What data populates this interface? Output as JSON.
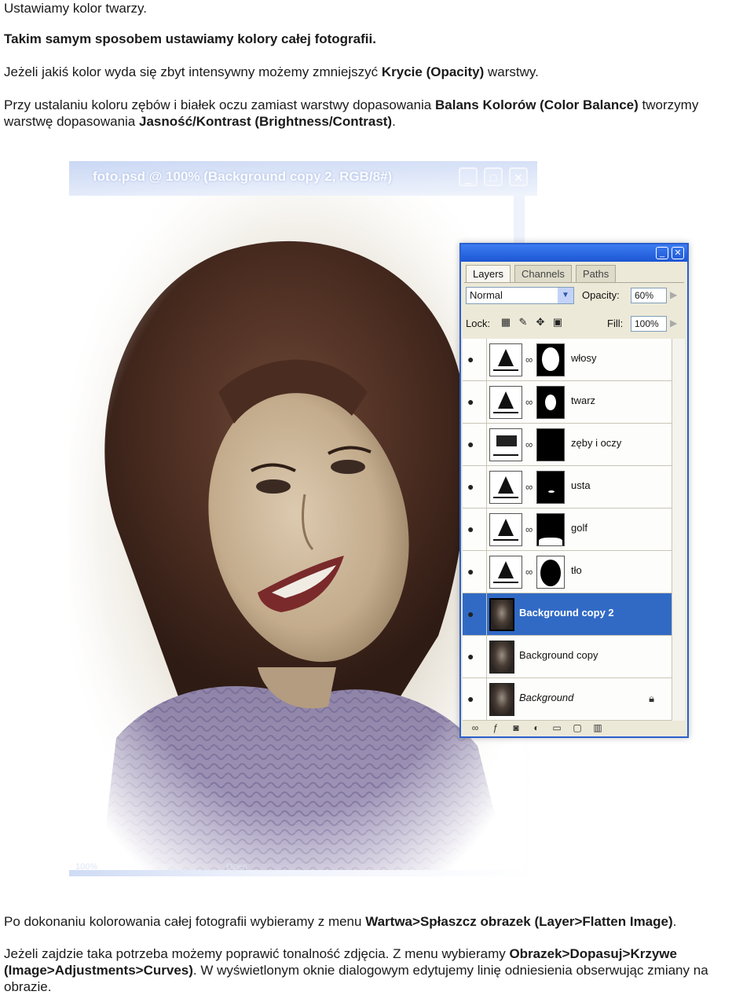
{
  "text": {
    "p1": "Ustawiamy kolor twarzy.",
    "p2": "Takim samym sposobem ustawiamy kolory całej fotografii.",
    "p3a": "Jeżeli jakiś kolor wyda się zbyt intensywny możemy zmniejszyć ",
    "p3b": "Krycie (Opacity)",
    "p3c": " warstwy.",
    "p4a": "Przy ustalaniu koloru zębów i białek oczu zamiast warstwy dopasowania ",
    "p4b": "Balans Kolorów (Color Balance)",
    "p4c": " tworzymy warstwę dopasowania ",
    "p4d": "Jasność/Kontrast (Brightness/Contrast)",
    "p4e": ".",
    "p5a": "Po dokonaniu kolorowania całej fotografii wybieramy z menu ",
    "p5b": "Wartwa>Spłaszcz obrazek (Layer>Flatten Image)",
    "p5c": ".",
    "p6a": "Jeżeli zajdzie taka potrzeba możemy poprawić tonalność zdjęcia. Z menu wybieramy ",
    "p6b": "Obrazek>Dopasuj>Krzywe (Image>Adjustments>Curves)",
    "p6c": ". W wyświetlonym oknie dialogowym edytujemy linię odniesienia obserwując zmiany na obrazie."
  },
  "document_window": {
    "title": "foto.psd @ 100% (Background copy 2, RGB/8#)",
    "status_zoom": "100%",
    "status_info": "Open"
  },
  "layers_panel": {
    "tabs": [
      "Layers",
      "Channels",
      "Paths"
    ],
    "blend_mode": "Normal",
    "opacity_label": "Opacity:",
    "opacity_value": "60%",
    "lock_label": "Lock:",
    "fill_label": "Fill:",
    "fill_value": "100%",
    "layers": [
      {
        "name": "włosy",
        "kind": "adjustment"
      },
      {
        "name": "twarz",
        "kind": "adjustment"
      },
      {
        "name": "zęby i oczy",
        "kind": "brightness"
      },
      {
        "name": "usta",
        "kind": "adjustment"
      },
      {
        "name": "golf",
        "kind": "adjustment"
      },
      {
        "name": "tło",
        "kind": "adjustment"
      },
      {
        "name": "Background copy 2",
        "kind": "photo",
        "selected": true
      },
      {
        "name": "Background copy",
        "kind": "photo"
      },
      {
        "name": "Background",
        "kind": "photo",
        "locked": true
      }
    ]
  },
  "colors": {
    "accent": "#316ac5",
    "titlebar": "#1d56d4",
    "panel_bg": "#ece9d8"
  }
}
